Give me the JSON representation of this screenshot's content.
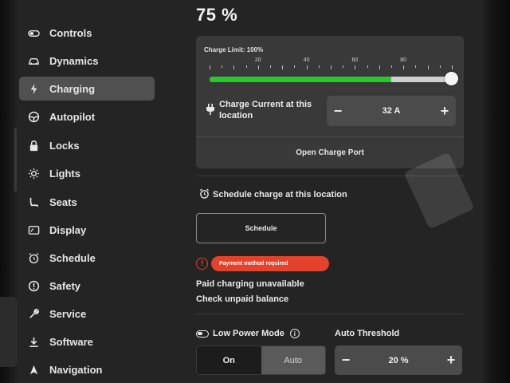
{
  "battery": {
    "percent": "75 %"
  },
  "sidebar": {
    "items": [
      {
        "label": "Controls",
        "icon": "toggle-icon",
        "active": false
      },
      {
        "label": "Dynamics",
        "icon": "car-icon",
        "active": false
      },
      {
        "label": "Charging",
        "icon": "lightning-icon",
        "active": true
      },
      {
        "label": "Autopilot",
        "icon": "steering-wheel-icon",
        "active": false
      },
      {
        "label": "Locks",
        "icon": "lock-icon",
        "active": false
      },
      {
        "label": "Lights",
        "icon": "sun-icon",
        "active": false
      },
      {
        "label": "Seats",
        "icon": "seat-icon",
        "active": false
      },
      {
        "label": "Display",
        "icon": "display-icon",
        "active": false
      },
      {
        "label": "Schedule",
        "icon": "alarm-clock-icon",
        "active": false
      },
      {
        "label": "Safety",
        "icon": "alert-circle-icon",
        "active": false
      },
      {
        "label": "Service",
        "icon": "wrench-icon",
        "active": false
      },
      {
        "label": "Software",
        "icon": "download-icon",
        "active": false
      },
      {
        "label": "Navigation",
        "icon": "navigation-arrow-icon",
        "active": false
      }
    ]
  },
  "charging": {
    "limit_label": "Charge Limit: 100%",
    "limit_value": 100,
    "current_fill": 75,
    "ticks": [
      "20",
      "40",
      "60",
      "80"
    ],
    "current_label": "Charge Current at this location",
    "current_value": "32 A",
    "open_port_label": "Open Charge Port",
    "fill_color": "#27c92a"
  },
  "schedule": {
    "heading": "Schedule charge at this location",
    "button_label": "Schedule"
  },
  "alert": {
    "badge": "Payment method required",
    "line1": "Paid charging unavailable",
    "line2": "Check unpaid balance",
    "color": "#e2432a"
  },
  "low_power": {
    "label": "Low Power Mode",
    "options": [
      "On",
      "Auto"
    ],
    "selected": "Auto"
  },
  "auto_threshold": {
    "label": "Auto Threshold",
    "value": "20 %"
  }
}
